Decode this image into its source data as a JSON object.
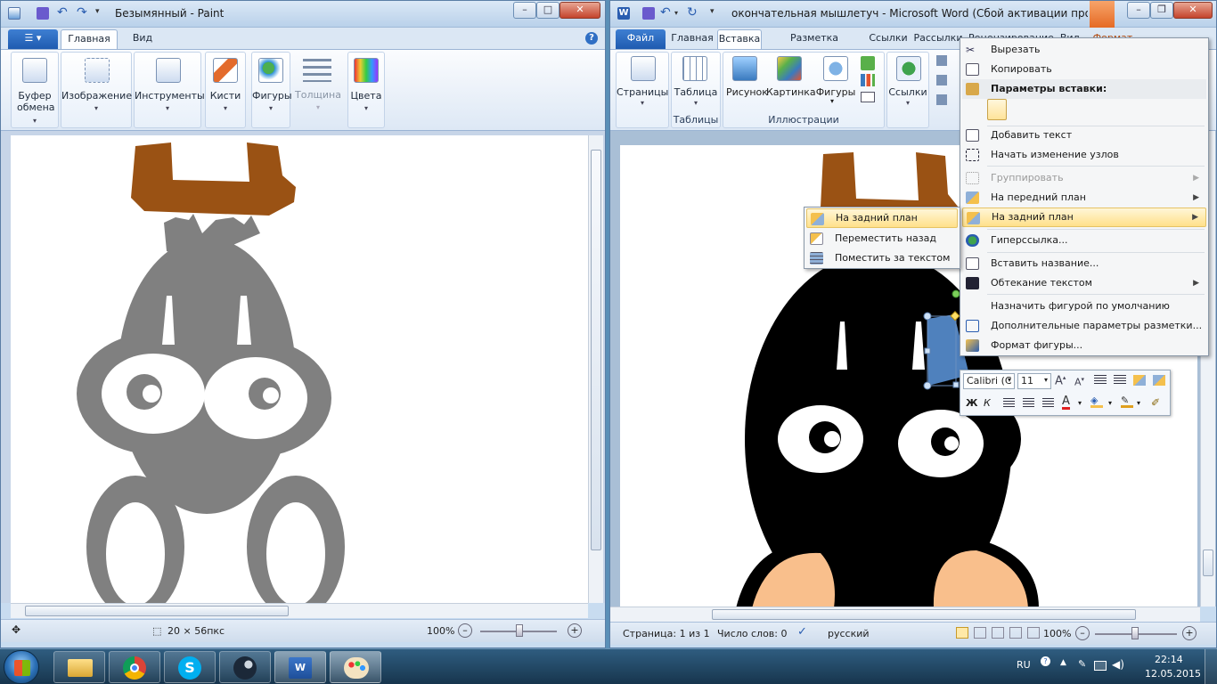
{
  "paint": {
    "title": "Безымянный - Paint",
    "tabs": [
      "Главная",
      "Вид"
    ],
    "groups": {
      "clipboard": "Буфер обмена",
      "image": "Изображение",
      "tools": "Инструменты",
      "brushes": "Кисти",
      "shapes": "Фигуры",
      "size": "Толщина",
      "colors": "Цвета"
    },
    "status": {
      "selection": "20 × 56пкс",
      "zoom": "100%"
    }
  },
  "word": {
    "title": "окончательная мышлетуч - Microsoft Word (Сбой активации проду...",
    "context_tab": "Формат",
    "tabs": [
      "Файл",
      "Главная",
      "Вставка",
      "Разметка страницы",
      "Ссылки",
      "Рассылки",
      "Рецензирование",
      "Вид"
    ],
    "groups": {
      "pages": "Страницы",
      "table": "Таблица",
      "tables_footer": "Таблицы",
      "picture": "Рисунок",
      "clipart": "Картинка",
      "shapes": "Фигуры",
      "illustrations_footer": "Иллюстрации",
      "links": "Ссылки"
    },
    "status": {
      "page": "Страница: 1 из 1",
      "words": "Число слов: 0",
      "language": "русский",
      "zoom": "100%"
    },
    "context_menu": {
      "cut": "Вырезать",
      "copy": "Копировать",
      "paste_options": "Параметры вставки:",
      "add_text": "Добавить текст",
      "edit_points": "Начать изменение узлов",
      "group": "Группировать",
      "bring_front": "На передний план",
      "send_back": "На задний план",
      "hyperlink": "Гиперссылка...",
      "insert_caption": "Вставить название...",
      "wrap_text": "Обтекание текстом",
      "set_default": "Назначить фигурой по умолчанию",
      "more_layout": "Дополнительные параметры разметки...",
      "format_shape": "Формат фигуры..."
    },
    "submenu": {
      "send_back": "На задний план",
      "send_backward": "Переместить назад",
      "behind_text": "Поместить за текстом"
    },
    "mini_toolbar": {
      "font": "Calibri (С",
      "size": "11",
      "bold": "Ж",
      "italic": "К"
    }
  },
  "taskbar": {
    "language": "RU",
    "time": "22:14",
    "date": "12.05.2015"
  },
  "colors": {
    "drawing_gray": "#808080",
    "drawing_brown": "#9a5214",
    "drawing_black": "#000000",
    "drawing_peach": "#f9bf8c",
    "shape_blue": "#4f81bd"
  }
}
